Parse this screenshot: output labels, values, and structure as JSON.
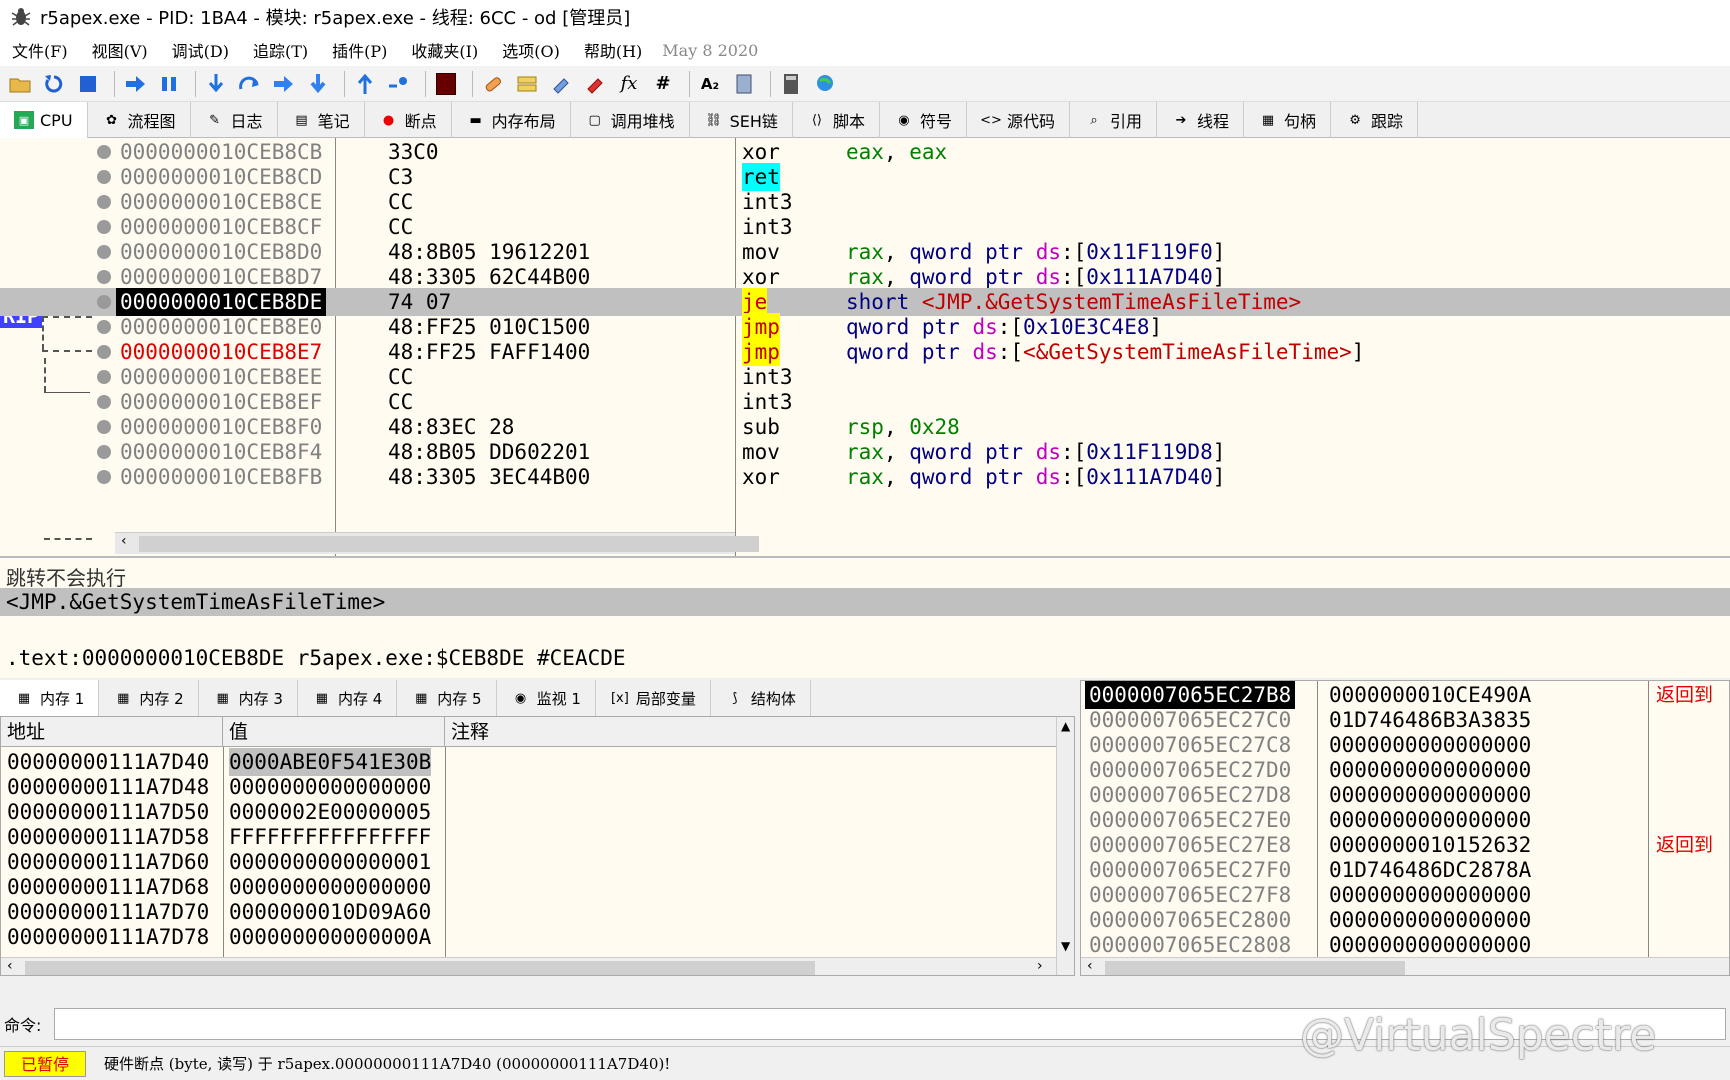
{
  "window": {
    "title": "r5apex.exe - PID: 1BA4 - 模块: r5apex.exe - 线程: 6CC - od [管理员]"
  },
  "menu": {
    "items": [
      "文件(F)",
      "视图(V)",
      "调试(D)",
      "追踪(T)",
      "插件(P)",
      "收藏夹(I)",
      "选项(O)",
      "帮助(H)"
    ],
    "date": "May 8 2020"
  },
  "toolbar": {
    "icons": [
      "open-icon",
      "restart-icon",
      "stop-icon",
      "run-icon",
      "pause-icon",
      "step-into-icon",
      "step-over-icon",
      "trace-into-icon",
      "trace-over-icon",
      "execute-till-return-icon",
      "run-to-user-code-icon",
      "scylla-icon",
      "patch-icon",
      "comment-icon",
      "label-icon",
      "bookmark-icon",
      "function-icon",
      "hash-icon",
      "strings-icon",
      "calculator-icon",
      "notes-icon",
      "globe-icon"
    ],
    "fx_label": "fx",
    "hash_label": "#",
    "strings_label": "A₂"
  },
  "tabs": [
    {
      "label": "CPU",
      "icon": "cpu-icon"
    },
    {
      "label": "流程图",
      "icon": "graph-icon"
    },
    {
      "label": "日志",
      "icon": "log-icon"
    },
    {
      "label": "笔记",
      "icon": "notes-icon"
    },
    {
      "label": "断点",
      "icon": "breakpoint-icon"
    },
    {
      "label": "内存布局",
      "icon": "memory-map-icon"
    },
    {
      "label": "调用堆栈",
      "icon": "call-stack-icon"
    },
    {
      "label": "SEH链",
      "icon": "seh-icon"
    },
    {
      "label": "脚本",
      "icon": "script-icon"
    },
    {
      "label": "符号",
      "icon": "symbols-icon"
    },
    {
      "label": "源代码",
      "icon": "source-icon"
    },
    {
      "label": "引用",
      "icon": "references-icon"
    },
    {
      "label": "线程",
      "icon": "threads-icon"
    },
    {
      "label": "句柄",
      "icon": "handles-icon"
    },
    {
      "label": "跟踪",
      "icon": "trace-icon"
    }
  ],
  "disasm": {
    "rip_label": "RIP",
    "rows": [
      {
        "addr": "0000000010CEB8CB",
        "bytes": "33C0",
        "mnem": "xor",
        "ops": "eax, eax"
      },
      {
        "addr": "0000000010CEB8CD",
        "bytes": "C3",
        "mnem": "ret",
        "ops": ""
      },
      {
        "addr": "0000000010CEB8CE",
        "bytes": "CC",
        "mnem": "int3",
        "ops": ""
      },
      {
        "addr": "0000000010CEB8CF",
        "bytes": "CC",
        "mnem": "int3",
        "ops": ""
      },
      {
        "addr": "0000000010CEB8D0",
        "bytes": "48:8B05 19612201",
        "mnem": "mov",
        "ops": "rax, qword ptr ds:[0x11F119F0]"
      },
      {
        "addr": "0000000010CEB8D7",
        "bytes": "48:3305 62C44B00",
        "mnem": "xor",
        "ops": "rax, qword ptr ds:[0x111A7D40]"
      },
      {
        "addr": "0000000010CEB8DE",
        "bytes": "74 07",
        "mnem": "je",
        "ops": "short <JMP.&GetSystemTimeAsFileTime>"
      },
      {
        "addr": "0000000010CEB8E0",
        "bytes": "48:FF25 010C1500",
        "mnem": "jmp",
        "ops": "qword ptr ds:[0x10E3C4E8]"
      },
      {
        "addr": "0000000010CEB8E7",
        "bytes": "48:FF25 FAFF1400",
        "mnem": "jmp",
        "ops": "qword ptr ds:[<&GetSystemTimeAsFileTime>]"
      },
      {
        "addr": "0000000010CEB8EE",
        "bytes": "CC",
        "mnem": "int3",
        "ops": ""
      },
      {
        "addr": "0000000010CEB8EF",
        "bytes": "CC",
        "mnem": "int3",
        "ops": ""
      },
      {
        "addr": "0000000010CEB8F0",
        "bytes": "48:83EC 28",
        "mnem": "sub",
        "ops": "rsp, 0x28"
      },
      {
        "addr": "0000000010CEB8F4",
        "bytes": "48:8B05 DD602201",
        "mnem": "mov",
        "ops": "rax, qword ptr ds:[0x11F119D8]"
      },
      {
        "addr": "0000000010CEB8FB",
        "bytes": "48:3305 3EC44B00",
        "mnem": "xor",
        "ops": "rax, qword ptr ds:[0x111A7D40]"
      }
    ]
  },
  "info": {
    "line1": "跳转不会执行",
    "line2": "<JMP.&GetSystemTimeAsFileTime>",
    "line4": ".text:0000000010CEB8DE r5apex.exe:$CEB8DE #CEACDE"
  },
  "memtabs": [
    {
      "label": "内存 1"
    },
    {
      "label": "内存 2"
    },
    {
      "label": "内存 3"
    },
    {
      "label": "内存 4"
    },
    {
      "label": "内存 5"
    },
    {
      "label": "监视 1"
    },
    {
      "label": "局部变量"
    },
    {
      "label": "结构体"
    }
  ],
  "dump": {
    "headers": {
      "addr": "地址",
      "value": "值",
      "comment": "注释"
    },
    "rows": [
      {
        "addr": "00000000111A7D40",
        "value": "0000ABE0F541E30B"
      },
      {
        "addr": "00000000111A7D48",
        "value": "0000000000000000"
      },
      {
        "addr": "00000000111A7D50",
        "value": "0000002E00000005"
      },
      {
        "addr": "00000000111A7D58",
        "value": "FFFFFFFFFFFFFFFF"
      },
      {
        "addr": "00000000111A7D60",
        "value": "0000000000000001"
      },
      {
        "addr": "00000000111A7D68",
        "value": "0000000000000000"
      },
      {
        "addr": "00000000111A7D70",
        "value": "0000000010D09A60"
      },
      {
        "addr": "00000000111A7D78",
        "value": "000000000000000A"
      }
    ]
  },
  "stack": {
    "rows": [
      {
        "addr": "0000007065EC27B8",
        "value": "0000000010CE490A",
        "comment": "返回到"
      },
      {
        "addr": "0000007065EC27C0",
        "value": "01D746486B3A3835",
        "comment": ""
      },
      {
        "addr": "0000007065EC27C8",
        "value": "0000000000000000",
        "comment": ""
      },
      {
        "addr": "0000007065EC27D0",
        "value": "0000000000000000",
        "comment": ""
      },
      {
        "addr": "0000007065EC27D8",
        "value": "0000000000000000",
        "comment": ""
      },
      {
        "addr": "0000007065EC27E0",
        "value": "0000000000000000",
        "comment": ""
      },
      {
        "addr": "0000007065EC27E8",
        "value": "0000000010152632",
        "comment": "返回到"
      },
      {
        "addr": "0000007065EC27F0",
        "value": "01D746486DC2878A",
        "comment": ""
      },
      {
        "addr": "0000007065EC27F8",
        "value": "0000000000000000",
        "comment": ""
      },
      {
        "addr": "0000007065EC2800",
        "value": "0000000000000000",
        "comment": ""
      },
      {
        "addr": "0000007065EC2808",
        "value": "0000000000000000",
        "comment": ""
      }
    ]
  },
  "command": {
    "label": "命令:",
    "value": ""
  },
  "status": {
    "state": "已暂停",
    "message": "硬件断点 (byte, 读写) 于 r5apex.00000000111A7D40 (00000000111A7D40)!"
  },
  "watermark": "@VirtualSpectre",
  "colors": {
    "rip": "#4040ff",
    "paused_bg": "#ffff00",
    "paused_fg": "#e00000",
    "ret_highlight": "#00ffff",
    "jump_highlight": "#ffff00"
  }
}
